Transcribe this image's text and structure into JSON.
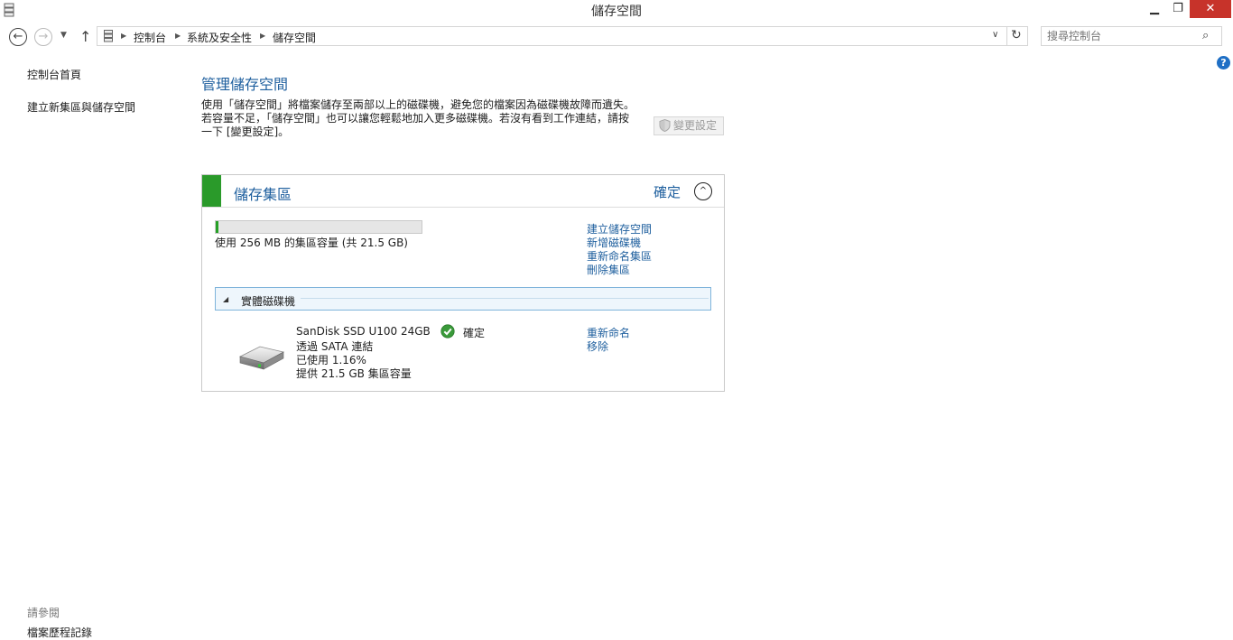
{
  "window": {
    "title": "儲存空間",
    "controls": {
      "minimize": "▁",
      "restore": "❐",
      "close": "✕"
    }
  },
  "nav": {
    "back_icon": "←",
    "forward_icon": "→",
    "recent_icon": "▼",
    "up_icon": "↑",
    "breadcrumbs": [
      "控制台",
      "系統及安全性",
      "儲存空間"
    ],
    "dropdown_icon": "∨",
    "refresh_icon": "↻",
    "search_placeholder": "搜尋控制台",
    "search_icon": "⌕"
  },
  "help_icon": "?",
  "sidebar": {
    "links": [
      "控制台首頁",
      "建立新集區與儲存空間"
    ],
    "see_also_heading": "請參閱",
    "see_also_links": [
      "檔案歷程記錄"
    ]
  },
  "main": {
    "title": "管理儲存空間",
    "description_lines": [
      "使用「儲存空間」將檔案儲存至兩部以上的磁碟機，避免您的檔案因為磁碟機故障而遺失。",
      "若容量不足，「儲存空間」也可以讓您輕鬆地加入更多磁碟機。若沒有看到工作連結，請按",
      "一下 [變更設定]。"
    ],
    "change_settings_label": "變更設定"
  },
  "pool": {
    "title": "儲存集區",
    "status": "確定",
    "collapse_icon": "^",
    "capacity_used_fraction": 0.0116,
    "capacity_text": "使用 256 MB 的集區容量 (共 21.5 GB)",
    "actions": [
      "建立儲存空間",
      "新增磁碟機",
      "重新命名集區",
      "刪除集區"
    ],
    "physical_drives": {
      "toggle_icon": "◢",
      "label": "實體磁碟機",
      "drives": [
        {
          "name": "SanDisk SSD U100 24GB",
          "connection": "透過 SATA 連結",
          "used": "已使用 1.16%",
          "provides": "提供 21.5 GB 集區容量",
          "status": "確定",
          "actions": [
            "重新命名",
            "移除"
          ]
        }
      ]
    }
  },
  "colors": {
    "link_blue": "#1e5f9e",
    "accent_green": "#2a9a2a",
    "close_red": "#c7332a"
  }
}
